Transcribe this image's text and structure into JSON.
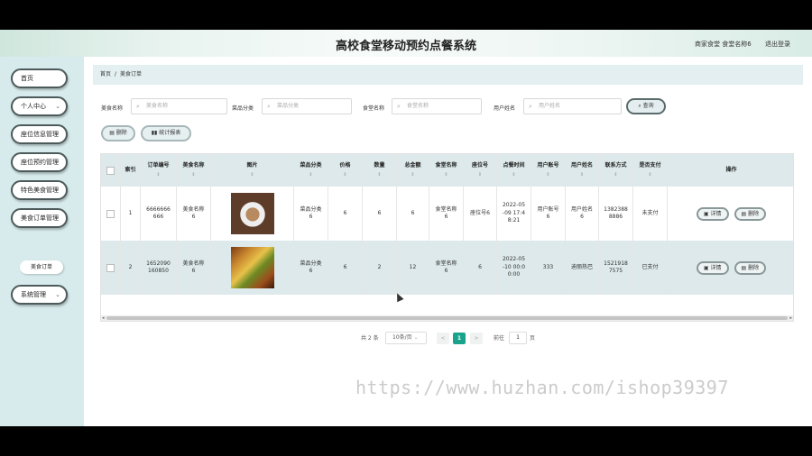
{
  "app": {
    "title": "高校食堂移动预约点餐系统",
    "merchant": "商家食堂 食堂名称6",
    "logout": "退出登录"
  },
  "sidebar": {
    "items": [
      {
        "label": "首页",
        "chevron": ""
      },
      {
        "label": "个人中心",
        "chevron": "⌄"
      },
      {
        "label": "座位信息管理",
        "chevron": ""
      },
      {
        "label": "座位预约管理",
        "chevron": ""
      },
      {
        "label": "特色美食管理",
        "chevron": ""
      },
      {
        "label": "美食订单管理",
        "chevron": ""
      },
      {
        "label": "系统管理",
        "chevron": "⌄"
      }
    ],
    "sub_items": [
      {
        "label": "美食订单"
      }
    ]
  },
  "breadcrumb": {
    "home": "首页",
    "sep": "/",
    "current": "美食订单"
  },
  "filters": [
    {
      "label": "美食名称",
      "placeholder": "美食名称"
    },
    {
      "label": "菜品分类",
      "placeholder": "菜品分类"
    },
    {
      "label": "食堂名称",
      "placeholder": "食堂名称"
    },
    {
      "label": "用户姓名",
      "placeholder": "用户姓名"
    }
  ],
  "search_icon": "magnifier-icon",
  "query_button": "查询",
  "actions": {
    "delete": "删除",
    "report": "统计报表"
  },
  "table": {
    "headers": [
      "",
      "索引",
      "订单编号",
      "美食名称",
      "图片",
      "菜品分类",
      "价格",
      "数量",
      "总金额",
      "食堂名称",
      "座位号",
      "点餐时间",
      "用户账号",
      "用户姓名",
      "联系方式",
      "是否支付",
      "操作"
    ],
    "sort_mark": "⇕",
    "rows": [
      {
        "index": "1",
        "order_no": "6666666\n666",
        "food_name": "美食名称\n6",
        "image": "food-photo-plate",
        "category": "菜品分类\n6",
        "price": "6",
        "qty": "6",
        "total": "6",
        "canteen": "食堂名称\n6",
        "seat": "座位号6",
        "time": "2022-05\n-09 17:4\n8:21",
        "account": "用户账号\n6",
        "user": "用户姓名\n6",
        "phone": "1382388\n8886",
        "paid": "未支付",
        "btn_detail": "详情",
        "btn_delete": "删除"
      },
      {
        "index": "2",
        "order_no": "1652090\n160850",
        "food_name": "美食名称\n6",
        "image": "food-photo-skewers",
        "category": "菜品分类\n6",
        "price": "6",
        "qty": "2",
        "total": "12",
        "canteen": "食堂名称\n6",
        "seat": "6",
        "time": "2022-05\n-10 00:0\n0:00",
        "account": "333",
        "user": "迪丽热巴",
        "phone": "1521918\n7575",
        "paid": "已支付",
        "btn_detail": "详情",
        "btn_delete": "删除"
      }
    ]
  },
  "pagination": {
    "total": "共 2 条",
    "page_size": "10条/页",
    "prev": "<",
    "current": "1",
    "next": ">",
    "goto": "前往",
    "goto_value": "1",
    "page_unit": "页"
  },
  "watermark": "https://www.huzhan.com/ishop39397"
}
